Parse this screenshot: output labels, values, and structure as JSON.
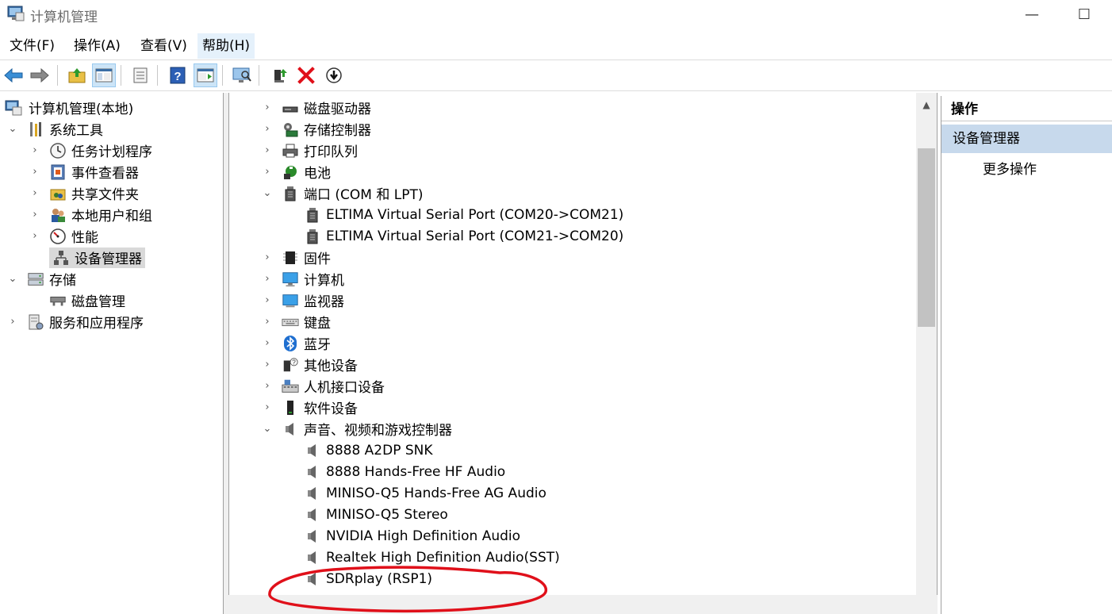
{
  "window": {
    "title": "计算机管理",
    "min_glyph": "—",
    "max_glyph": "☐"
  },
  "menu": {
    "items": [
      "文件(F)",
      "操作(A)",
      "查看(V)",
      "帮助(H)"
    ]
  },
  "left_tree": {
    "items": [
      {
        "label": "计算机管理(本地)",
        "icon": "computer-management-icon"
      },
      {
        "label": "系统工具",
        "icon": "tools-icon"
      },
      {
        "label": "任务计划程序",
        "icon": "clock-icon"
      },
      {
        "label": "事件查看器",
        "icon": "event-viewer-icon"
      },
      {
        "label": "共享文件夹",
        "icon": "shared-folder-icon"
      },
      {
        "label": "本地用户和组",
        "icon": "users-icon"
      },
      {
        "label": "性能",
        "icon": "performance-icon"
      },
      {
        "label": "设备管理器",
        "icon": "device-manager-icon"
      },
      {
        "label": "存储",
        "icon": "storage-icon"
      },
      {
        "label": "磁盘管理",
        "icon": "disk-management-icon"
      },
      {
        "label": "服务和应用程序",
        "icon": "services-icon"
      }
    ]
  },
  "device_tree": {
    "items": [
      {
        "label": "磁盘驱动器",
        "icon": "disk-drive-icon"
      },
      {
        "label": "存储控制器",
        "icon": "storage-controller-icon"
      },
      {
        "label": "打印队列",
        "icon": "printer-icon"
      },
      {
        "label": "电池",
        "icon": "battery-icon"
      },
      {
        "label": "端口 (COM 和 LPT)",
        "icon": "port-icon"
      },
      {
        "label": "ELTIMA Virtual Serial Port (COM20->COM21)",
        "icon": "port-icon"
      },
      {
        "label": "ELTIMA Virtual Serial Port (COM21->COM20)",
        "icon": "port-icon"
      },
      {
        "label": "固件",
        "icon": "firmware-icon"
      },
      {
        "label": "计算机",
        "icon": "computer-icon"
      },
      {
        "label": "监视器",
        "icon": "monitor-icon"
      },
      {
        "label": "键盘",
        "icon": "keyboard-icon"
      },
      {
        "label": "蓝牙",
        "icon": "bluetooth-icon"
      },
      {
        "label": "其他设备",
        "icon": "other-devices-icon"
      },
      {
        "label": "人机接口设备",
        "icon": "hid-icon"
      },
      {
        "label": "软件设备",
        "icon": "software-device-icon"
      },
      {
        "label": "声音、视频和游戏控制器",
        "icon": "speaker-icon"
      },
      {
        "label": "8888 A2DP SNK",
        "icon": "speaker-icon"
      },
      {
        "label": "8888 Hands-Free HF Audio",
        "icon": "speaker-icon"
      },
      {
        "label": "MINISO-Q5 Hands-Free AG Audio",
        "icon": "speaker-icon"
      },
      {
        "label": "MINISO-Q5 Stereo",
        "icon": "speaker-icon"
      },
      {
        "label": "NVIDIA High Definition Audio",
        "icon": "speaker-icon"
      },
      {
        "label": "Realtek High Definition Audio(SST)",
        "icon": "speaker-icon"
      },
      {
        "label": "SDRplay (RSP1)",
        "icon": "speaker-icon"
      }
    ]
  },
  "actions": {
    "header": "操作",
    "subheader": "设备管理器",
    "more": "更多操作"
  },
  "colors": {
    "annotation": "#e0101a",
    "selection": "#d9d9d9",
    "actions_highlight": "#c7d9ec"
  }
}
